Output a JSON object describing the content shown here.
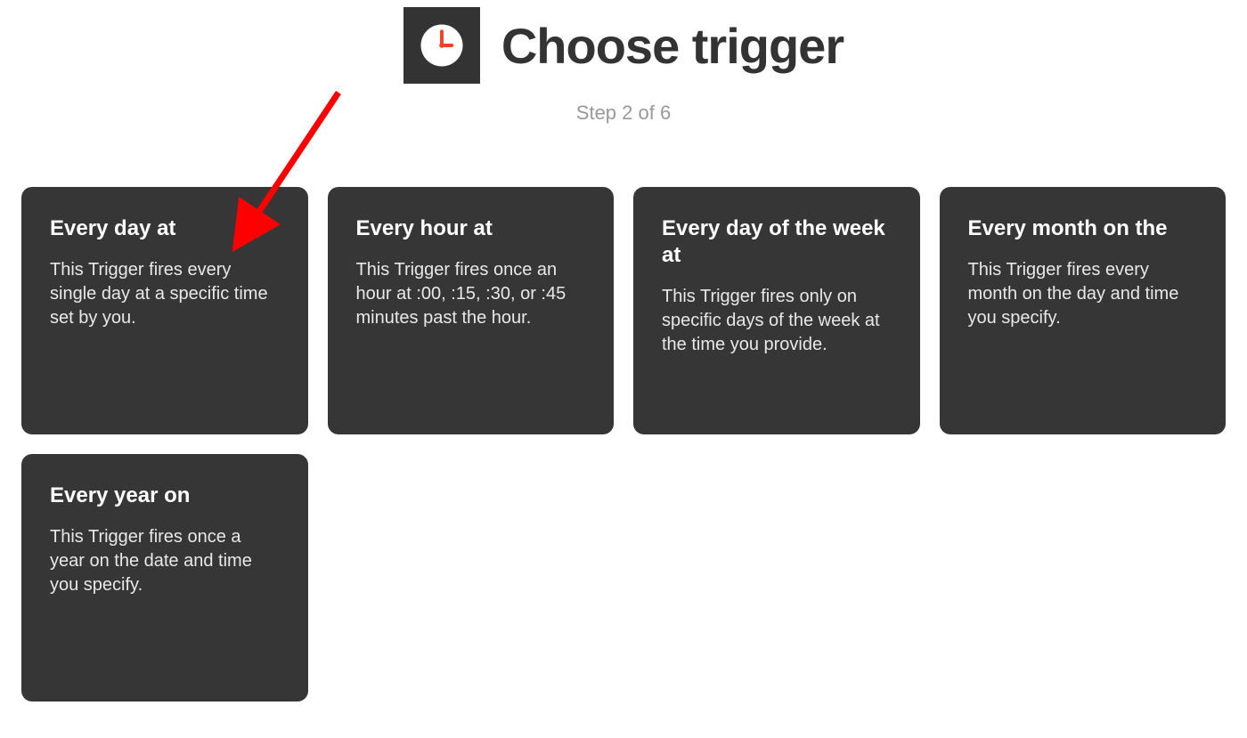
{
  "header": {
    "icon": "clock-icon",
    "title": "Choose trigger",
    "step": "Step 2 of 6"
  },
  "triggers": [
    {
      "title": "Every day at",
      "description": "This Trigger fires every single day at a specific time set by you."
    },
    {
      "title": "Every hour at",
      "description": "This Trigger fires once an hour at :00, :15, :30, or :45 minutes past the hour."
    },
    {
      "title": "Every day of the week at",
      "description": "This Trigger fires only on specific days of the week at the time you provide."
    },
    {
      "title": "Every month on the",
      "description": "This Trigger fires every month on the day and time you specify."
    },
    {
      "title": "Every year on",
      "description": "This Trigger fires once a year on the date and time you specify."
    }
  ],
  "annotation": {
    "type": "arrow",
    "color": "#ff0000",
    "points_at": "Every day at"
  }
}
